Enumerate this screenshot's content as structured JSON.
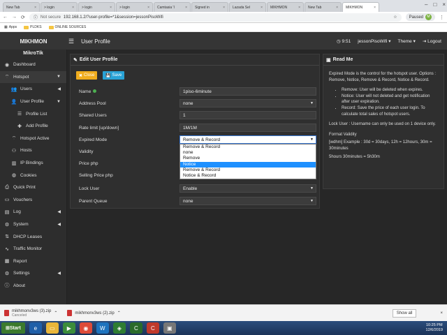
{
  "browser": {
    "tabs": [
      {
        "label": "New Tab"
      },
      {
        "label": "> login"
      },
      {
        "label": "> login"
      },
      {
        "label": "> login"
      },
      {
        "label": "Camtasia 'I"
      },
      {
        "label": "Signed in"
      },
      {
        "label": "Lazada Sel"
      },
      {
        "label": "MIKHMON"
      },
      {
        "label": "New Tab"
      },
      {
        "label": "MIKHMON"
      }
    ],
    "address_not_secure": "Not secure",
    "url": "192.168.1.2/?user-profile=*1&session=jessonPisoWifi",
    "paused_label": "Paused",
    "avatar_letter": "M",
    "bookmarks": [
      "Apps",
      "PLDKS",
      "ONLINE SOURCES"
    ]
  },
  "header": {
    "brand": "MIKHMON",
    "page_title": "User Profile",
    "time": "9:51",
    "session": "jessonPisoWifi",
    "theme": "Theme",
    "logout": "Logout"
  },
  "sidebar": {
    "title": "MikroTik",
    "items": [
      {
        "label": "Dashboard",
        "icon": "dashboard-icon"
      },
      {
        "label": "Hotspot",
        "icon": "wifi-icon"
      },
      {
        "label": "Users",
        "icon": "users-icon"
      },
      {
        "label": "User Profile",
        "icon": "user-profile-icon"
      },
      {
        "label": "Profile List",
        "icon": "list-icon"
      },
      {
        "label": "Add Profile",
        "icon": "plus-icon"
      },
      {
        "label": "Hotspot Active",
        "icon": "wifi-icon"
      },
      {
        "label": "Hosts",
        "icon": "hosts-icon"
      },
      {
        "label": "IP Bindings",
        "icon": "bindings-icon"
      },
      {
        "label": "Cookies",
        "icon": "cookie-icon"
      },
      {
        "label": "Quick Print",
        "icon": "print-icon"
      },
      {
        "label": "Vouchers",
        "icon": "ticket-icon"
      },
      {
        "label": "Log",
        "icon": "log-icon"
      },
      {
        "label": "System",
        "icon": "gear-icon"
      },
      {
        "label": "DHCP Leases",
        "icon": "dhcp-icon"
      },
      {
        "label": "Traffic Monitor",
        "icon": "traffic-icon"
      },
      {
        "label": "Report",
        "icon": "report-icon"
      },
      {
        "label": "Settings",
        "icon": "settings-icon"
      },
      {
        "label": "About",
        "icon": "info-icon"
      }
    ]
  },
  "edit": {
    "title": "Edit User Profile",
    "close_label": "Close",
    "save_label": "Save",
    "fields": [
      {
        "label": "Name",
        "value": "1piso-6minute"
      },
      {
        "label": "Address Pool",
        "value": "none"
      },
      {
        "label": "Shared Users",
        "value": "1"
      },
      {
        "label": "Rate limit [up/down]",
        "value": "1M/1M"
      },
      {
        "label": "Expired Mode",
        "value": "Remove & Record"
      },
      {
        "label": "Validity",
        "value": ""
      },
      {
        "label": "Price php",
        "value": ""
      },
      {
        "label": "Selling Price php",
        "value": ""
      },
      {
        "label": "Lock User",
        "value": "Enable"
      },
      {
        "label": "Parent Queue",
        "value": "none"
      }
    ],
    "expired_options": [
      "Remove & Record",
      "none",
      "Remove",
      "Notice",
      "Remove & Record",
      "Notice & Record"
    ],
    "highlighted_option": "Notice"
  },
  "readme": {
    "title": "Read Me",
    "intro": "Expired Mode is the control for the hotspot user. Options : Remove, Notice, Remove & Record, Notice & Record.",
    "bullets": [
      "Remove: User will be deleted when expires.",
      "Notice: User will not deleted and get notification after user expiration.",
      "Record: Save the price of each user login. To calculate total sales of hotspot users."
    ],
    "lock_user": "Lock User : Username can only be used on 1 device only.",
    "format_title": "Format Validity",
    "format_example": "[wdhm] Example : 30d = 30days, 12h = 12hours, 30m = 30minutes",
    "format_example2": "5hours 30minutes = 5h30m"
  },
  "downloads": {
    "items": [
      {
        "name": "mikhmonv3ws (3).zip",
        "status": "Canceled"
      },
      {
        "name": "mikhmonv3ws (2).zip",
        "status": ""
      }
    ],
    "show_all": "Show all"
  },
  "taskbar": {
    "start": "Start",
    "time": "10:25 PM",
    "date": "12/6/2019"
  }
}
